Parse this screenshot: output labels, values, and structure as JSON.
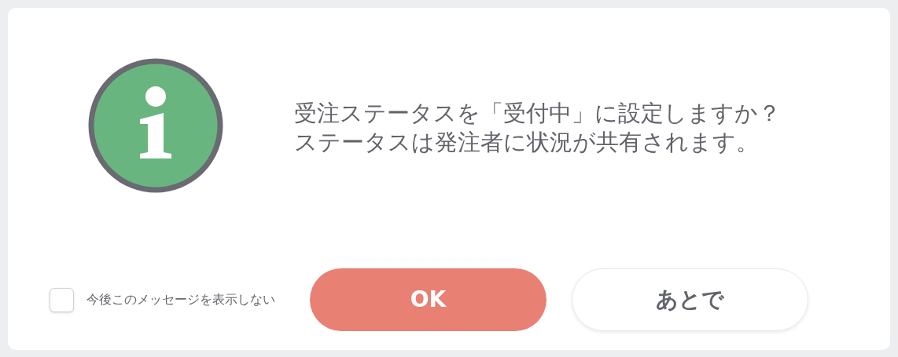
{
  "dialog": {
    "message_lines": [
      "受注ステータスを「受付中」に設定しますか？",
      "ステータスは発注者に状況が共有されます。"
    ],
    "dont_show_again": {
      "label": "今後このメッセージを表示しない",
      "checked": false
    },
    "buttons": [
      {
        "label": "OK",
        "kind": "primary"
      },
      {
        "label": "あとで",
        "kind": "secondary"
      }
    ]
  }
}
